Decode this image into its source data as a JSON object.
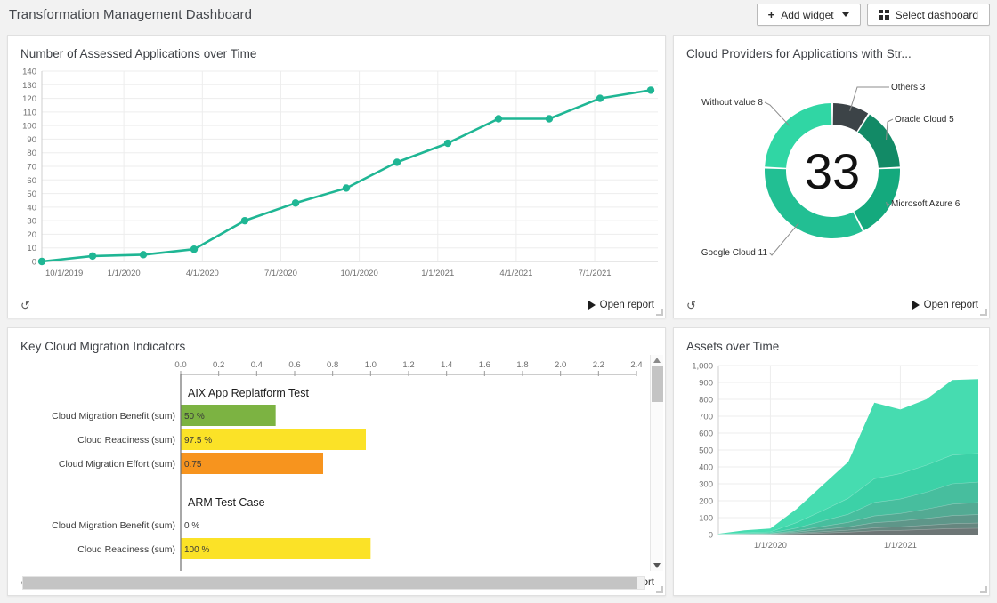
{
  "header": {
    "title": "Transformation Management Dashboard",
    "add_widget_label": "Add widget",
    "select_dashboard_label": "Select dashboard",
    "icons": {
      "add": "plus-icon",
      "dropdown": "chevron-down-icon",
      "dashboard": "grid-icon"
    }
  },
  "common": {
    "open_report_label": "Open report",
    "refresh_icon": "refresh-icon",
    "play_icon": "play-icon"
  },
  "panels": {
    "line": {
      "title": "Number of Assessed Applications over Time"
    },
    "donut": {
      "title": "Cloud Providers for Applications with Str..."
    },
    "bar": {
      "title": "Key Cloud Migration Indicators"
    },
    "area": {
      "title": "Assets over Time"
    }
  },
  "chart_data": [
    {
      "id": "assessed-applications-over-time",
      "type": "line",
      "title": "Number of Assessed Applications over Time",
      "xlabel": "",
      "ylabel": "",
      "grid": true,
      "legend": false,
      "ylim": [
        0,
        140
      ],
      "yticks": [
        0,
        10,
        20,
        30,
        40,
        50,
        60,
        70,
        80,
        90,
        100,
        110,
        120,
        130,
        140
      ],
      "xtick_labels": [
        "10/1/2019",
        "1/1/2020",
        "4/1/2020",
        "7/1/2020",
        "10/1/2020",
        "1/1/2021",
        "4/1/2021",
        "7/1/2021"
      ],
      "series_color": "#1fb694",
      "x": [
        "10/1/2019",
        "12/1/2019",
        "2/1/2020",
        "4/1/2020",
        "6/1/2020",
        "8/1/2020",
        "10/1/2020",
        "12/1/2020",
        "2/1/2021",
        "4/1/2021",
        "6/1/2021",
        "8/1/2021",
        "10/1/2021"
      ],
      "values": [
        0,
        4,
        5,
        9,
        30,
        43,
        54,
        73,
        87,
        105,
        105,
        120,
        126
      ]
    },
    {
      "id": "cloud-providers-donut",
      "type": "pie",
      "title": "Cloud Providers for Applications with Str...",
      "center_value": "33",
      "total": 33,
      "legend": "callout-labels",
      "slices": [
        {
          "label": "Others 3",
          "name": "Others",
          "value": 3,
          "color": "#3c4347"
        },
        {
          "label": "Oracle Cloud 5",
          "name": "Oracle Cloud",
          "value": 5,
          "color": "#128a66"
        },
        {
          "label": "Microsoft Azure 6",
          "name": "Microsoft Azure",
          "value": 6,
          "color": "#14a97d"
        },
        {
          "label": "Google Cloud 11",
          "name": "Google Cloud",
          "value": 11,
          "color": "#22bf93"
        },
        {
          "label": "Without value 8",
          "name": "Without value",
          "value": 8,
          "color": "#30d6a4"
        }
      ]
    },
    {
      "id": "key-cloud-migration-indicators",
      "type": "bar",
      "title": "Key Cloud Migration Indicators",
      "orientation": "horizontal",
      "xlim": [
        0.0,
        2.4
      ],
      "xticks": [
        "0.0",
        "0.2",
        "0.4",
        "0.6",
        "0.8",
        "1.0",
        "1.2",
        "1.4",
        "1.6",
        "1.8",
        "2.0",
        "2.2",
        "2.4"
      ],
      "groups": [
        {
          "group_title": "AIX App Replatform Test",
          "bars": [
            {
              "category": "Cloud Migration Benefit (sum)",
              "value_label": "50 %",
              "value": 0.5,
              "color": "#7cb342"
            },
            {
              "category": "Cloud Readiness (sum)",
              "value_label": "97.5 %",
              "value": 0.975,
              "color": "#fbe227"
            },
            {
              "category": "Cloud Migration Effort (sum)",
              "value_label": "0.75",
              "value": 0.75,
              "color": "#f7941e"
            }
          ]
        },
        {
          "group_title": "ARM Test Case",
          "bars": [
            {
              "category": "Cloud Migration Benefit (sum)",
              "value_label": "0 %",
              "value": 0.0,
              "color": "#7cb342"
            },
            {
              "category": "Cloud Readiness (sum)",
              "value_label": "100 %",
              "value": 1.0,
              "color": "#fbe227"
            }
          ]
        }
      ]
    },
    {
      "id": "assets-over-time",
      "type": "area",
      "stacked": true,
      "title": "Assets over Time",
      "xlabel": "",
      "ylabel": "",
      "grid": true,
      "legend": false,
      "ylim": [
        0,
        1000
      ],
      "yticks": [
        "0",
        "100",
        "200",
        "300",
        "400",
        "500",
        "600",
        "700",
        "800",
        "900",
        "1,000"
      ],
      "xtick_labels": [
        "1/1/2020",
        "1/1/2021"
      ],
      "top_series_color": "#46dcb0",
      "x": [
        "7/1/2019",
        "10/1/2019",
        "1/1/2020",
        "4/1/2020",
        "7/1/2020",
        "10/1/2020",
        "11/1/2020",
        "1/1/2021",
        "4/1/2021",
        "7/1/2021",
        "10/1/2021"
      ],
      "total_values": [
        5,
        25,
        35,
        150,
        290,
        430,
        780,
        740,
        800,
        915,
        920
      ],
      "band_values": [
        [
          2,
          10,
          16,
          70,
          140,
          215,
          330,
          360,
          410,
          470,
          480
        ],
        [
          1,
          6,
          10,
          38,
          80,
          120,
          190,
          210,
          250,
          300,
          310
        ],
        [
          1,
          4,
          6,
          22,
          48,
          72,
          110,
          125,
          150,
          180,
          190
        ],
        [
          0,
          2,
          4,
          14,
          30,
          45,
          70,
          80,
          95,
          112,
          118
        ],
        [
          0,
          1,
          2,
          8,
          17,
          26,
          40,
          46,
          55,
          64,
          68
        ],
        [
          0,
          1,
          1,
          4,
          9,
          14,
          22,
          25,
          30,
          35,
          37
        ]
      ]
    }
  ]
}
